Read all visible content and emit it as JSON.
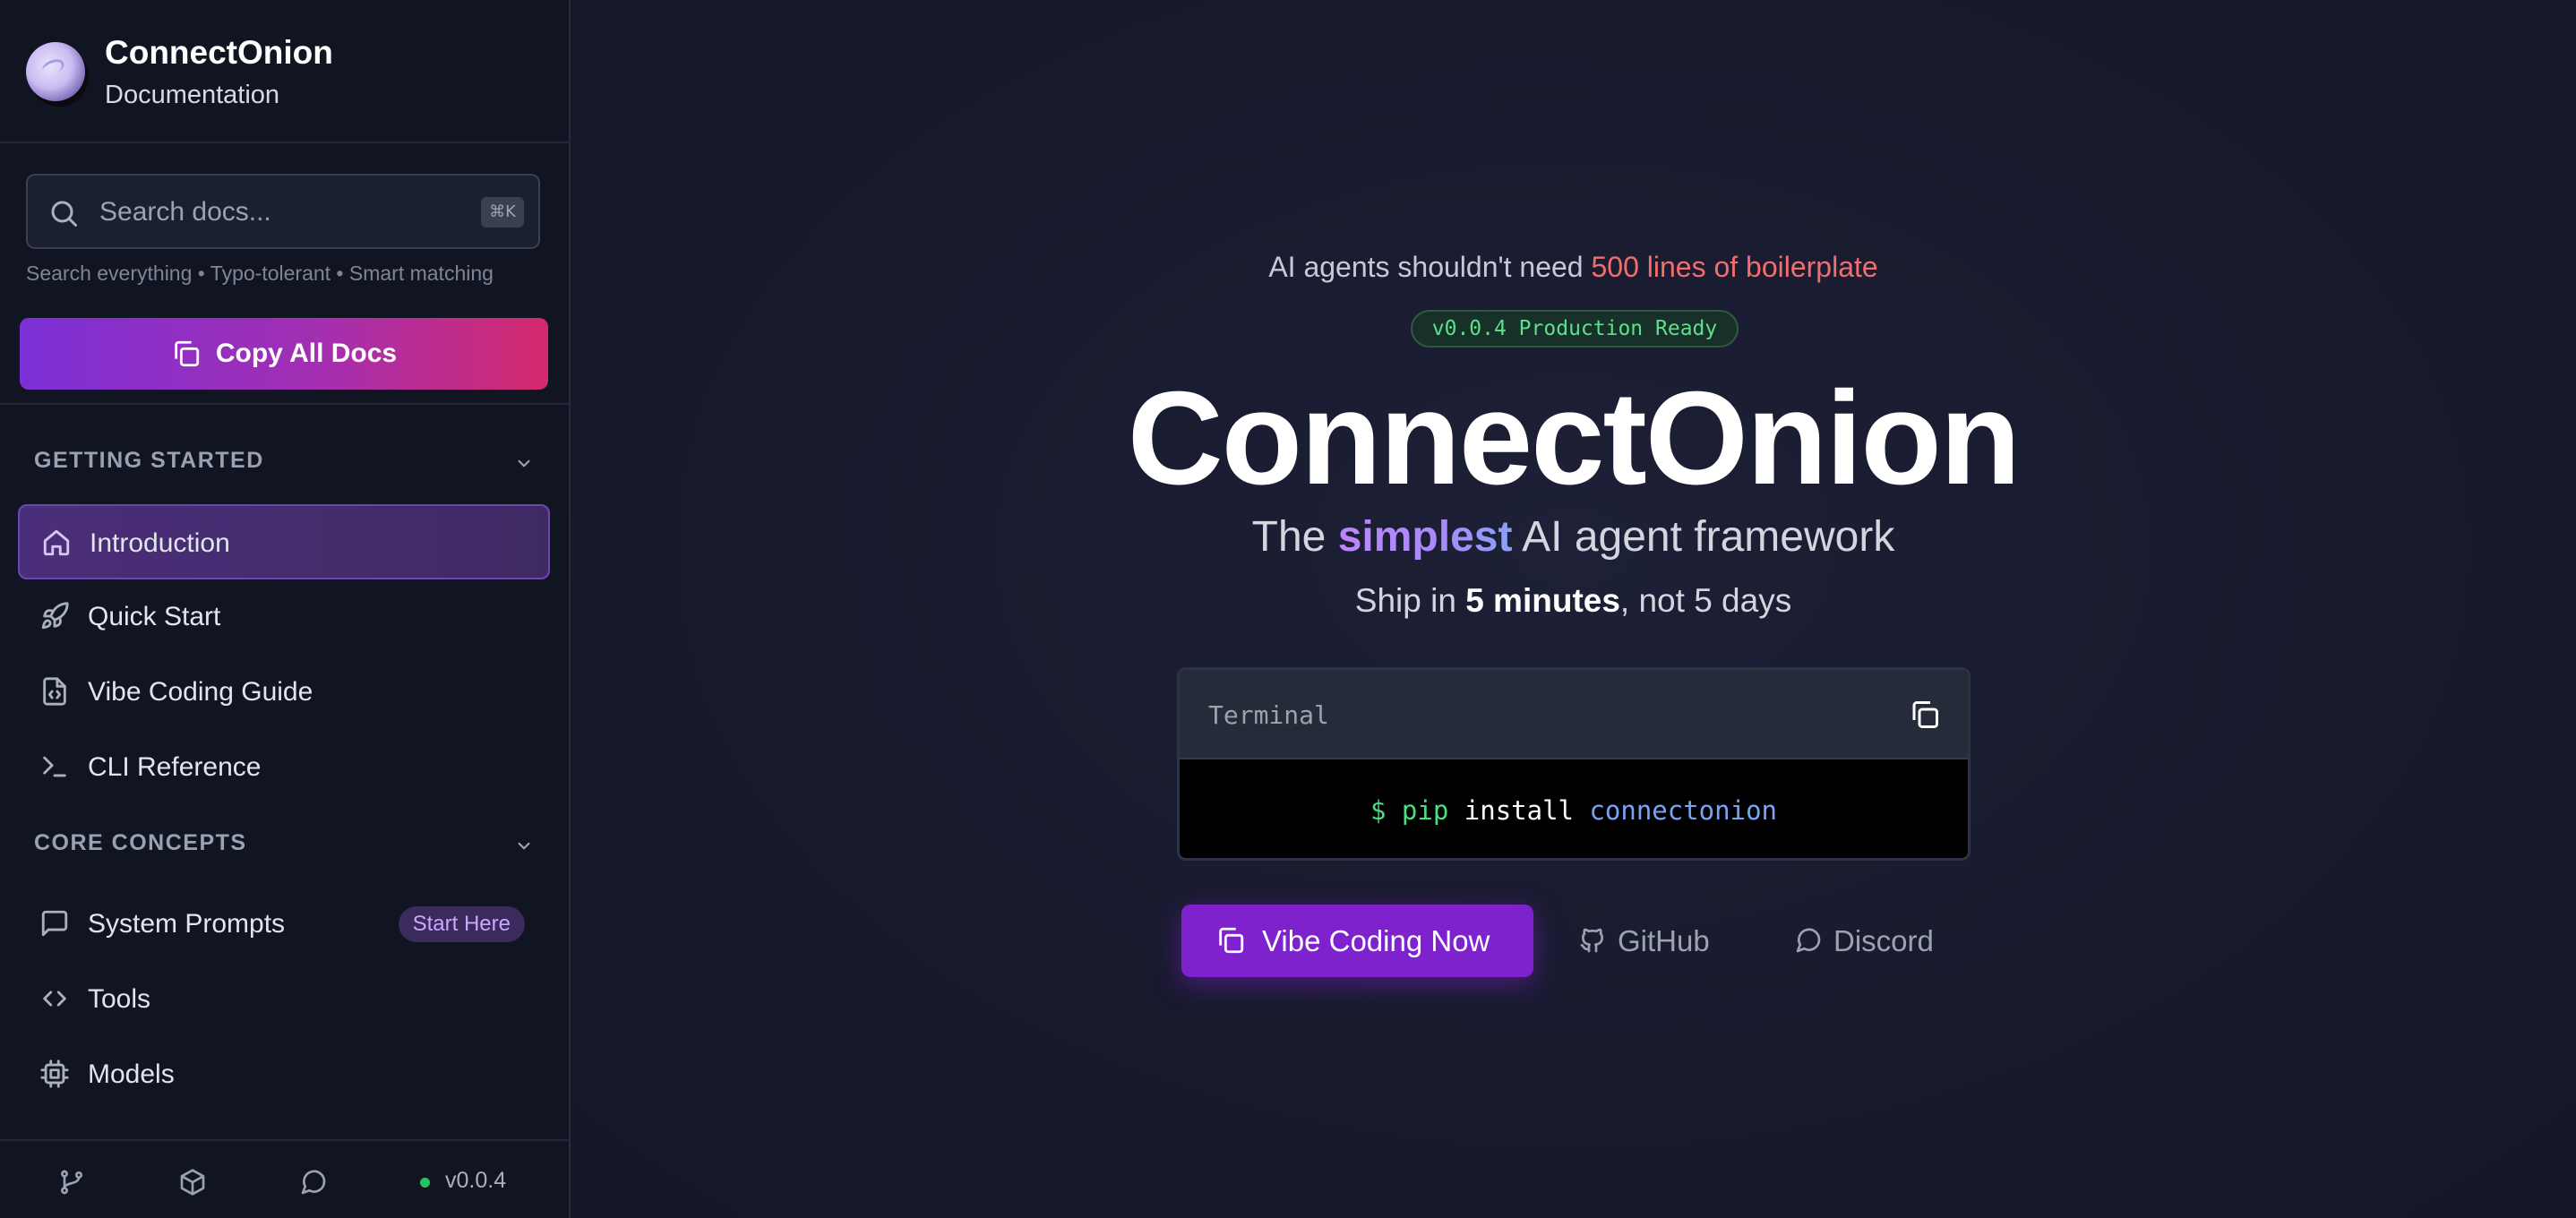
{
  "sidebar": {
    "brand_name": "ConnectOnion",
    "brand_sub": "Documentation",
    "search_placeholder": "Search docs...",
    "search_shortcut": "⌘K",
    "search_hint": "Search everything • Typo-tolerant • Smart matching",
    "copy_all_label": "Copy All Docs",
    "sections": [
      {
        "title": "GETTING STARTED",
        "items": [
          {
            "label": "Introduction",
            "icon": "home-icon",
            "active": true
          },
          {
            "label": "Quick Start",
            "icon": "rocket-icon"
          },
          {
            "label": "Vibe Coding Guide",
            "icon": "file-code-icon"
          },
          {
            "label": "CLI Reference",
            "icon": "terminal-icon"
          }
        ]
      },
      {
        "title": "CORE CONCEPTS",
        "items": [
          {
            "label": "System Prompts",
            "icon": "message-square-icon",
            "badge": "Start Here"
          },
          {
            "label": "Tools",
            "icon": "code-icon"
          },
          {
            "label": "Models",
            "icon": "cpu-icon"
          }
        ]
      }
    ],
    "footer": {
      "icons": [
        "git-branch-icon",
        "package-icon",
        "chat-icon"
      ],
      "version": "v0.0.4",
      "status_color": "#22c55e"
    }
  },
  "hero": {
    "tagline_prefix": "AI agents shouldn't need ",
    "tagline_highlight": "500 lines of boilerplate",
    "version_badge": "v0.0.4 Production Ready",
    "title": "ConnectOnion",
    "subtitle_prefix": "The ",
    "subtitle_highlight": "simplest",
    "subtitle_suffix": " AI agent framework",
    "ship_prefix": "Ship in ",
    "ship_bold": "5 minutes",
    "ship_suffix": ", not 5 days",
    "terminal": {
      "title": "Terminal",
      "prompt": "$ pip",
      "command": " install ",
      "package": "connectonion"
    },
    "buttons": {
      "primary": "Vibe Coding Now",
      "github": "GitHub",
      "discord": "Discord"
    }
  },
  "colors": {
    "accent": "#7e22ce",
    "highlight_red": "#f26d6d",
    "success_green": "#5ee08a",
    "package_blue": "#7aa2f7"
  }
}
